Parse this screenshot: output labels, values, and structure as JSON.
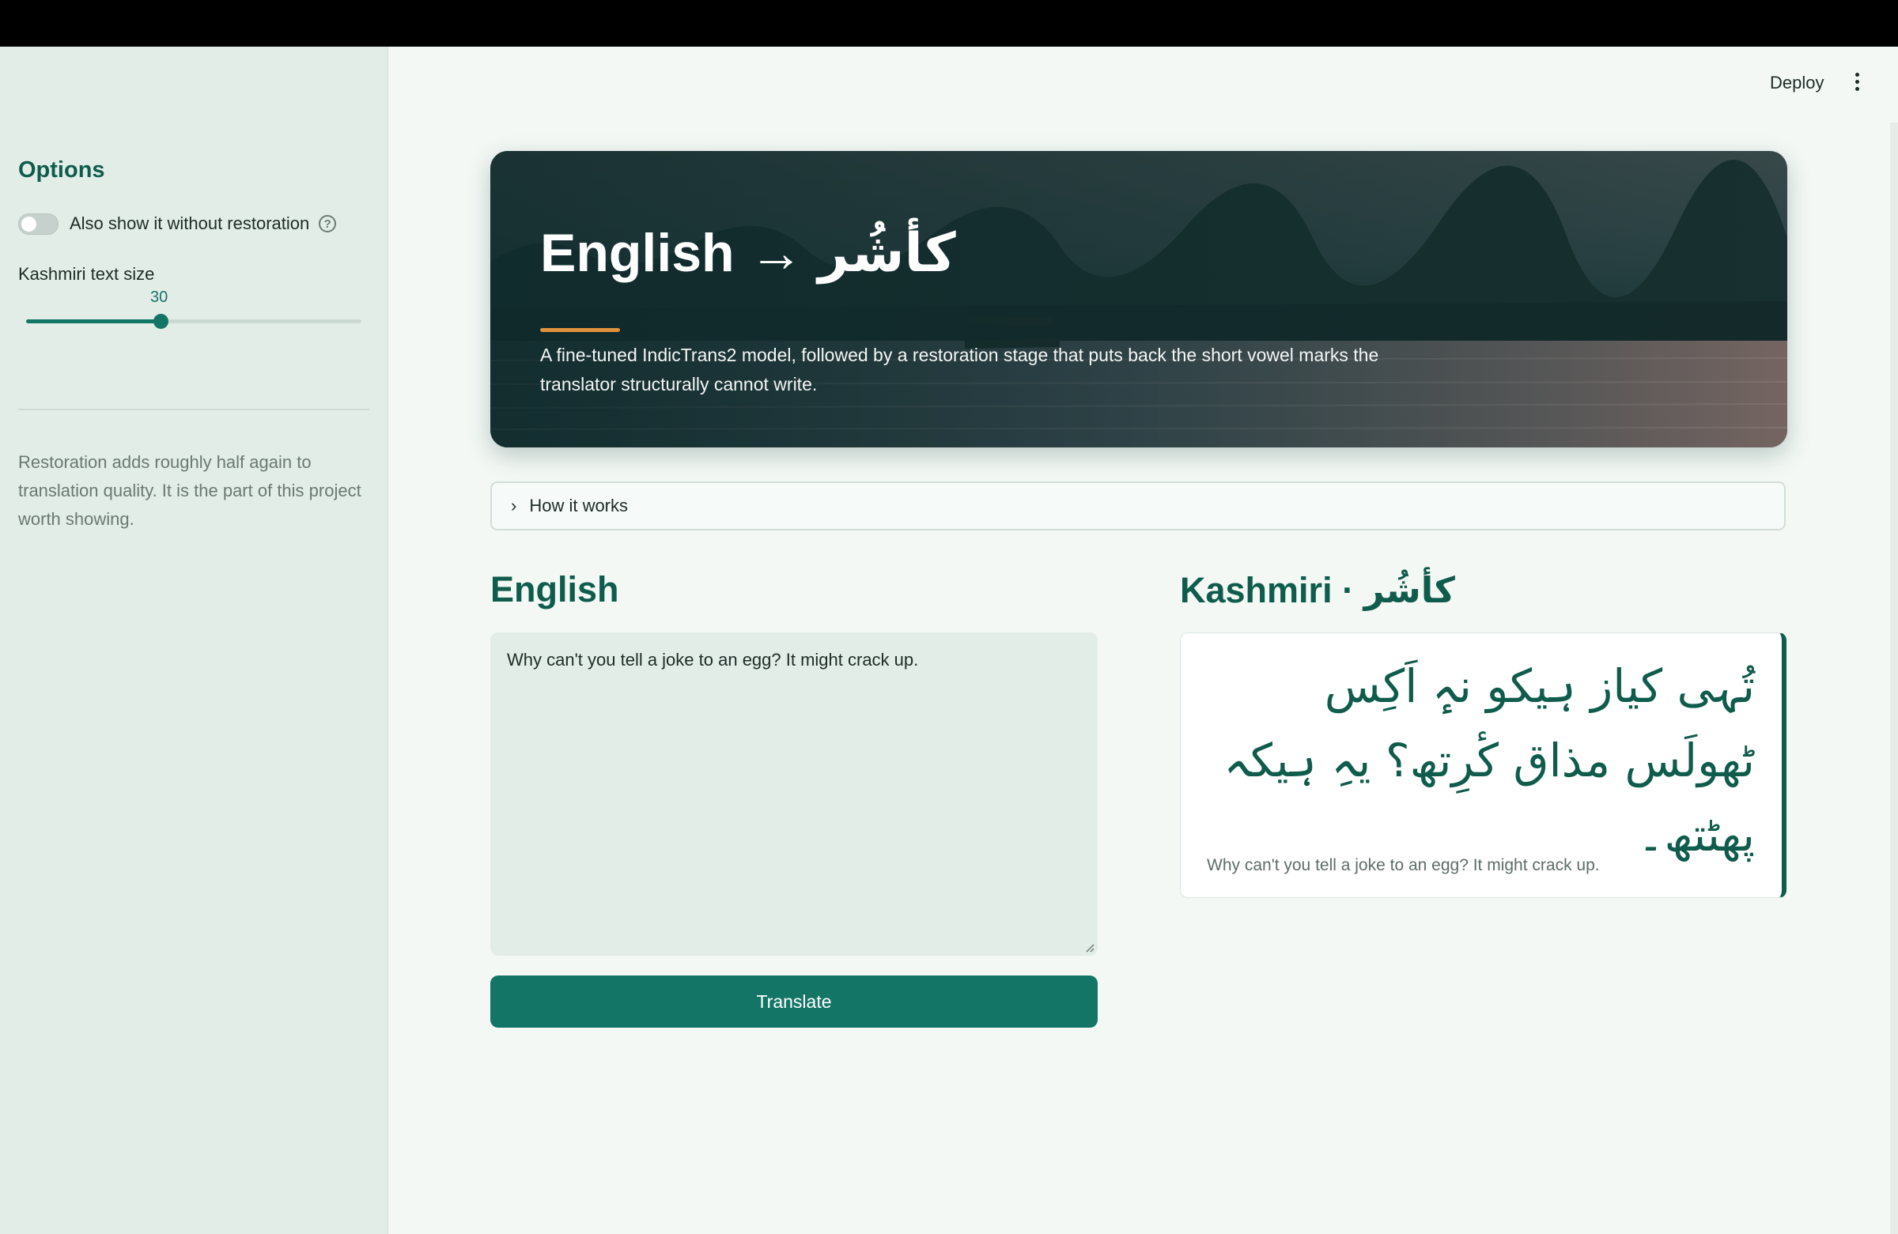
{
  "sidebar": {
    "title": "Options",
    "toggle_label": "Also show it without restoration",
    "toggle_on": false,
    "slider_label": "Kashmiri text size",
    "slider_value": "30",
    "slider_fraction": 0.4,
    "note": "Restoration adds roughly half again to translation quality. It is the part of this project worth showing."
  },
  "header": {
    "deploy_label": "Deploy"
  },
  "hero": {
    "title": "English → کأشُر",
    "description": "A fine-tuned IndicTrans2 model, followed by a restoration stage that puts back the short vowel marks the translator structurally cannot write."
  },
  "expander": {
    "label": "How it works"
  },
  "english": {
    "heading": "English",
    "input_value": "Why can't you tell a joke to an egg? It might crack up.",
    "button_label": "Translate"
  },
  "kashmiri": {
    "heading": "Kashmiri · کأشُر",
    "output_text": "تُہی کیاز ہیکو نہٕ اَکِس ٹھولَس مذاق کٔرِتھ؟ یہِ ہیکہ پھٹتھ۔",
    "source_echo": "Why can't you tell a joke to an egg? It might crack up."
  },
  "colors": {
    "accent": "#137566",
    "heading": "#0f5c4c",
    "hero_underline": "#e0913b"
  },
  "icons": {
    "help": "help-circle-icon",
    "kebab": "more-vertical-icon",
    "chevron": "chevron-right-icon"
  }
}
